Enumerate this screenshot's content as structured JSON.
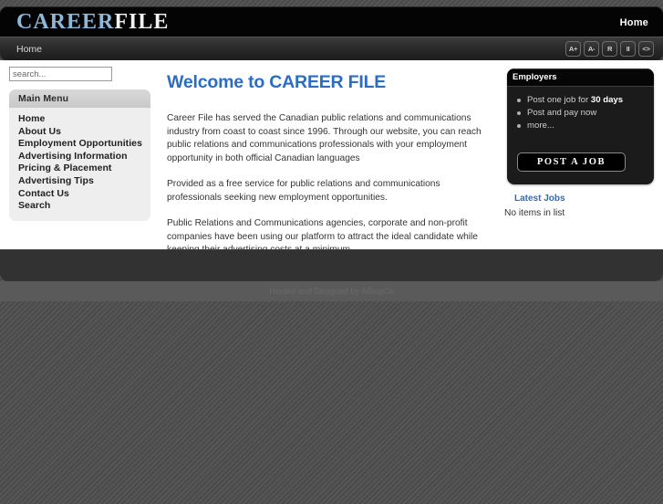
{
  "header": {
    "logo_primary": "CAREER",
    "logo_secondary": "FILE",
    "nav_home": "Home"
  },
  "toolbar": {
    "breadcrumb": "Home",
    "buttons": [
      {
        "label": "A+",
        "name": "increase-font-size-button"
      },
      {
        "label": "A-",
        "name": "decrease-font-size-button"
      },
      {
        "label": "R",
        "name": "reset-font-size-button"
      },
      {
        "label": "II",
        "name": "pause-button"
      },
      {
        "label": "<>",
        "name": "width-toggle-button"
      }
    ]
  },
  "sidebar": {
    "search_placeholder": "search...",
    "search_value": "",
    "menu_title": "Main Menu",
    "items": [
      {
        "label": "Home"
      },
      {
        "label": "About Us"
      },
      {
        "label": "Employment Opportunities"
      },
      {
        "label": "Advertising Information"
      },
      {
        "label": "Pricing & Placement"
      },
      {
        "label": "Advertising Tips"
      },
      {
        "label": "Contact Us"
      },
      {
        "label": "Search"
      }
    ]
  },
  "main": {
    "title": "Welcome to CAREER FILE",
    "paragraph_1": "Career File has served the Canadian public relations and communications industry from coast to coast since 1996.  Through our website, you can reach public relations and communications professionals with your employment opportunity in both official Canadian languages",
    "paragraph_2": "Provided as a free service for public relations and communications professionals seeking new employment opportunities.",
    "paragraph_3": "Public Relations and Communications agencies, corporate and non-profit companies have been using our platform to attract the ideal candidate while keeping their advertising costs at a minimum."
  },
  "employers": {
    "title": "Employers",
    "bullet_1_prefix": "Post one job for ",
    "bullet_1_strong": "30 days",
    "bullet_2": "Post and pay now",
    "bullet_3": "more...",
    "cta_label": "POST A JOB"
  },
  "latest_jobs": {
    "title": "Latest Jobs",
    "empty_text": "No items in list"
  },
  "footer": {
    "credit": "Hosted and Designed by ABlogCo"
  },
  "colors": {
    "accent_blue": "#2b6cc4",
    "logo_blue": "#8fb8d8",
    "header_black": "#040404",
    "module_gray": "#eeeeee"
  }
}
